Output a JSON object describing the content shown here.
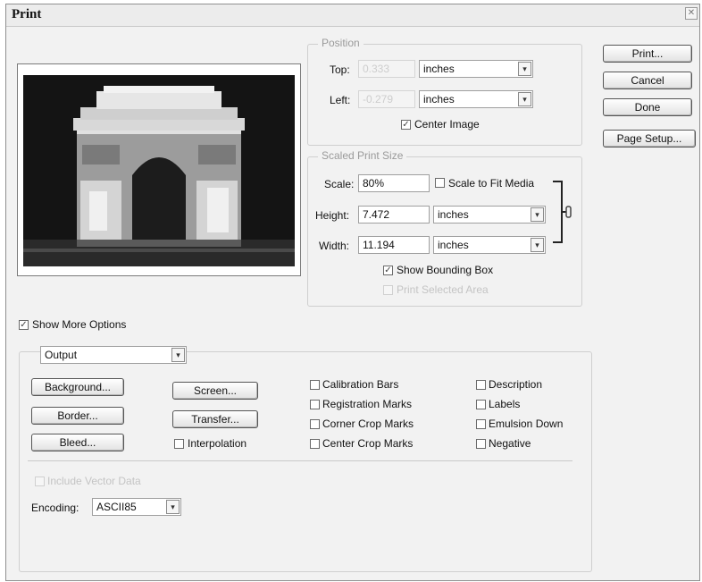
{
  "title": "Print",
  "buttons": {
    "print": "Print...",
    "cancel": "Cancel",
    "done": "Done",
    "page_setup": "Page Setup..."
  },
  "position": {
    "legend": "Position",
    "top_label": "Top:",
    "top_value": "0.333",
    "top_unit": "inches",
    "left_label": "Left:",
    "left_value": "-0.279",
    "left_unit": "inches",
    "center_image": "Center Image"
  },
  "scaled": {
    "legend": "Scaled Print Size",
    "scale_label": "Scale:",
    "scale_value": "80%",
    "scale_to_fit": "Scale to Fit Media",
    "height_label": "Height:",
    "height_value": "7.472",
    "height_unit": "inches",
    "width_label": "Width:",
    "width_value": "11.194",
    "width_unit": "inches",
    "show_bounding_box": "Show Bounding Box",
    "print_selected_area": "Print Selected Area"
  },
  "show_more_options": "Show More Options",
  "output": {
    "dropdown": "Output",
    "background": "Background...",
    "border": "Border...",
    "bleed": "Bleed...",
    "screen": "Screen...",
    "transfer": "Transfer...",
    "interpolation": "Interpolation",
    "calibration_bars": "Calibration Bars",
    "registration_marks": "Registration Marks",
    "corner_crop_marks": "Corner Crop Marks",
    "center_crop_marks": "Center Crop Marks",
    "description": "Description",
    "labels": "Labels",
    "emulsion_down": "Emulsion Down",
    "negative": "Negative",
    "include_vector_data": "Include Vector Data",
    "encoding_label": "Encoding:",
    "encoding_value": "ASCII85"
  },
  "icons": {
    "check": "✓",
    "dropdown_arrow": "▾",
    "close": "✕",
    "link": "link-icon"
  }
}
